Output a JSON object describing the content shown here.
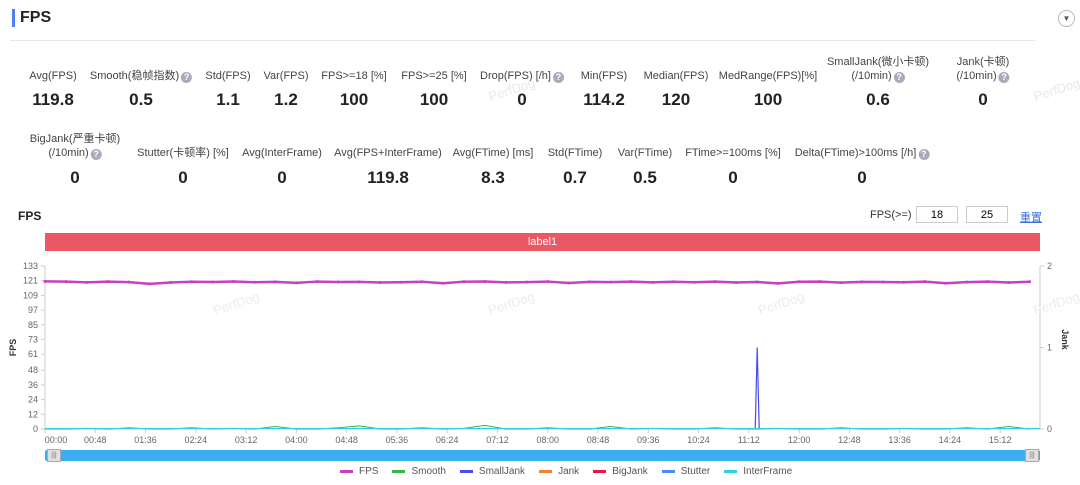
{
  "header": {
    "title": "FPS",
    "collapse_icon": "chevron-down-icon"
  },
  "metrics_row1": [
    {
      "label": "Avg(FPS)",
      "value": "119.8",
      "help": false
    },
    {
      "label": "Smooth(稳帧指数)",
      "value": "0.5",
      "help": true
    },
    {
      "label": "Std(FPS)",
      "value": "1.1",
      "help": false
    },
    {
      "label": "Var(FPS)",
      "value": "1.2",
      "help": false
    },
    {
      "label": "FPS>=18 [%]",
      "value": "100",
      "help": false
    },
    {
      "label": "FPS>=25 [%]",
      "value": "100",
      "help": false
    },
    {
      "label": "Drop(FPS) [/h]",
      "value": "0",
      "help": true
    },
    {
      "label": "Min(FPS)",
      "value": "114.2",
      "help": false
    },
    {
      "label": "Median(FPS)",
      "value": "120",
      "help": false
    },
    {
      "label": "MedRange(FPS)[%]",
      "value": "100",
      "help": false
    },
    {
      "label": "SmallJank(微小卡顿)",
      "label2": "(/10min)",
      "value": "0.6",
      "help": true
    },
    {
      "label": "Jank(卡顿)",
      "label2": "(/10min)",
      "value": "0",
      "help": true
    }
  ],
  "metrics_row2": [
    {
      "label": "BigJank(严重卡顿)",
      "label2": "(/10min)",
      "value": "0",
      "help": true
    },
    {
      "label": "Stutter(卡顿率) [%]",
      "value": "0",
      "help": false
    },
    {
      "label": "Avg(InterFrame)",
      "value": "0",
      "help": false
    },
    {
      "label": "Avg(FPS+InterFrame)",
      "value": "119.8",
      "help": false
    },
    {
      "label": "Avg(FTime) [ms]",
      "value": "8.3",
      "help": false
    },
    {
      "label": "Std(FTime)",
      "value": "0.7",
      "help": false
    },
    {
      "label": "Var(FTime)",
      "value": "0.5",
      "help": false
    },
    {
      "label": "FTime>=100ms [%]",
      "value": "0",
      "help": false
    },
    {
      "label": "Delta(FTime)>100ms [/h]",
      "value": "0",
      "help": true
    }
  ],
  "watermark": "PerfDog",
  "chart_controls": {
    "title": "FPS",
    "fps_label": "FPS(>=)",
    "threshold1": "18",
    "threshold2": "25",
    "reset_label": "重置"
  },
  "label_band": {
    "text": "label1",
    "color": "#ec5766"
  },
  "chart_data": {
    "type": "line",
    "ylabel": "FPS",
    "y2label": "Jank",
    "ylim": [
      0,
      133
    ],
    "y2lim": [
      0,
      2
    ],
    "yticks": [
      0,
      12,
      24,
      36,
      48,
      61,
      73,
      85,
      97,
      109,
      121,
      133
    ],
    "y2ticks": [
      0,
      1,
      2
    ],
    "xticks": [
      "00:00",
      "00:48",
      "01:36",
      "02:24",
      "03:12",
      "04:00",
      "04:48",
      "05:36",
      "06:24",
      "07:12",
      "08:00",
      "08:48",
      "09:36",
      "10:24",
      "11:12",
      "12:00",
      "12:48",
      "13:36",
      "14:24",
      "15:12"
    ],
    "x_range_seconds": [
      0,
      950
    ],
    "x_step_seconds": 20,
    "series": [
      {
        "name": "FPS",
        "color": "#c83fc0",
        "axis": "left",
        "values": [
          120.5,
          120.3,
          119.6,
          120.2,
          119.8,
          118.4,
          119.5,
          120.1,
          119.9,
          120.4,
          119.7,
          120.0,
          119.2,
          120.3,
          119.9,
          120.0,
          119.5,
          119.7,
          120.1,
          118.9,
          120.2,
          120.4,
          119.6,
          119.8,
          120.3,
          119.1,
          120.0,
          119.8,
          120.2,
          119.6,
          120.1,
          119.7,
          120.3,
          119.5,
          119.9,
          118.8,
          120.1,
          120.2,
          119.4,
          120.0,
          119.9,
          119.7,
          120.2,
          118.9,
          119.8,
          120.3,
          119.5,
          120.1
        ]
      },
      {
        "name": "Smooth",
        "color": "#3cb44b",
        "axis": "left",
        "values": [
          0,
          0,
          0.5,
          0,
          1,
          0,
          0,
          1,
          0,
          0.5,
          0,
          2,
          0,
          0,
          1,
          2.5,
          0,
          0,
          1,
          0,
          0.5,
          3,
          0,
          0,
          1,
          0,
          0,
          2,
          0,
          0.5,
          0,
          0,
          1,
          0,
          0,
          0.5,
          0,
          0,
          1,
          0,
          0,
          0.5,
          0,
          0,
          1,
          0,
          2,
          0
        ]
      },
      {
        "name": "SmallJank",
        "color": "#4b4bf0",
        "axis": "right",
        "spike_time": "11:20",
        "spike_value": 1
      },
      {
        "name": "Jank",
        "color": "#f58231",
        "axis": "right",
        "values": [
          0
        ]
      },
      {
        "name": "BigJank",
        "color": "#e6194b",
        "axis": "right",
        "values": [
          0
        ]
      },
      {
        "name": "Stutter",
        "color": "#4a8cf5",
        "axis": "right",
        "values": [
          0
        ]
      },
      {
        "name": "InterFrame",
        "color": "#2ed0e0",
        "axis": "right",
        "values": [
          0
        ]
      }
    ],
    "legend_position": "bottom"
  }
}
